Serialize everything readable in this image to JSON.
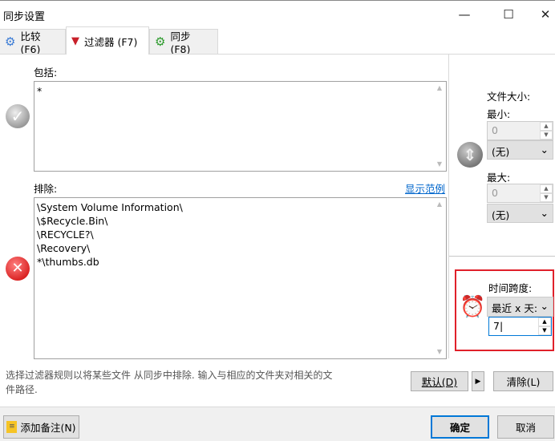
{
  "window": {
    "title": "同步设置",
    "minimize": "—",
    "maximize": "☐",
    "close": "✕"
  },
  "tabs": [
    {
      "label": "比较 (F6)",
      "icon": "gear-blue-icon"
    },
    {
      "label": "过滤器 (F7)",
      "icon": "funnel-icon",
      "active": true
    },
    {
      "label": "同步 (F8)",
      "icon": "gear-green-icon"
    }
  ],
  "include": {
    "label": "包括:",
    "value": "*"
  },
  "exclude": {
    "label": "排除:",
    "show_examples": "显示范例",
    "lines": [
      "\\System Volume Information\\",
      "\\$Recycle.Bin\\",
      "\\RECYCLE?\\",
      "\\Recovery\\",
      "*\\thumbs.db"
    ]
  },
  "file_size": {
    "label": "文件大小:",
    "min_label": "最小:",
    "min_value": "0",
    "min_unit": "(无)",
    "max_label": "最大:",
    "max_value": "0",
    "max_unit": "(无)"
  },
  "time_span": {
    "label": "时间跨度:",
    "mode": "最近 x 天:",
    "value": "7"
  },
  "description": "选择过滤器规则以将某些文件 从同步中排除. 输入与相应的文件夹对相关的文件路径.",
  "buttons": {
    "default": "默认(D)",
    "clear": "清除(L)",
    "add_note": "添加备注(N)",
    "ok": "确定",
    "cancel": "取消"
  }
}
